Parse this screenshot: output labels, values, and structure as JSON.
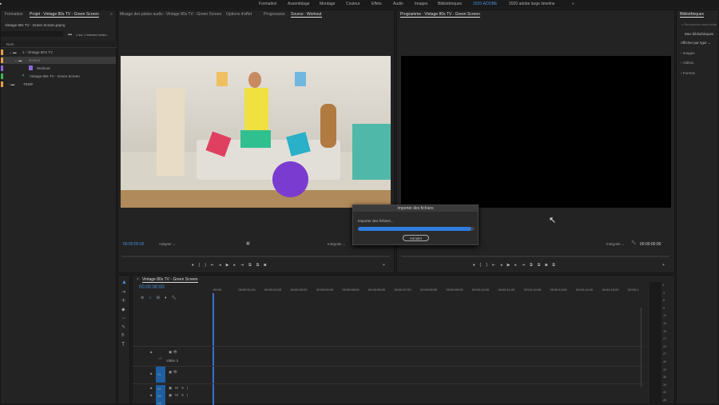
{
  "workspaces": [
    "Formation",
    "Assemblage",
    "Montage",
    "Couleur",
    "Effets",
    "Audio",
    "Images",
    "Bibliothèques",
    "2020-ADOBE",
    "2020 adobe large timeline"
  ],
  "workspace_active": "2020-ADOBE",
  "project": {
    "tab_formation": "Formation",
    "tab_project": "Projet : Vintage 80s TV - Green Screen",
    "file": "Vintage 80s TV - Green Screen.prproj",
    "selection": "1 sur 1 élément sélec...",
    "col_name": "Nom",
    "items": [
      {
        "label": "1 - Vintage 80's TV",
        "color": "#e8a03c"
      },
      {
        "label": "Source",
        "color": "#e8a03c"
      },
      {
        "label": "Workout",
        "color": "#8a6ad8"
      },
      {
        "label": "Vintage 80s TV - Green Screen",
        "color": "#3cb84a"
      },
      {
        "label": "TEMP",
        "color": "#e8a03c"
      }
    ]
  },
  "source": {
    "tabs": [
      "Mixage des pistes audio : Vintage 80s TV - Green Screen",
      "Options d'effet",
      "Progression",
      "Source : Workout"
    ],
    "timecode": "00:00:00:00",
    "fit": "Adapter",
    "quality": "Intégrale"
  },
  "program": {
    "tab": "Programme : Vintage 80s TV - Green Screen",
    "timecode": "00:00:00:00",
    "quality": "Intégrale"
  },
  "libraries": {
    "tab": "Bibliothèques",
    "search_placeholder": "Rechercher dans Adob",
    "my_libs": "Mes bibliothèques",
    "view_by": "Afficher par type",
    "sections": [
      "Images",
      "Vidéos",
      "Formes"
    ]
  },
  "dialog": {
    "title": "Importer des fichiers",
    "message": "Importer des fichiers...",
    "progress": 0.97,
    "cancel": "Annuler"
  },
  "timeline": {
    "tab": "Vintage 80s TV - Green Screen",
    "timecode": "00:00:00:00",
    "ruler": [
      ":00:00",
      "00:00:01:00",
      "00:00:02:00",
      "00:00:03:00",
      "00:00:04:00",
      "00:00:05:00",
      "00:00:06:00",
      "00:00:07:00",
      "00:00:08:00",
      "00:00:09:00",
      "00:00:10:00",
      "00:00:11:00",
      "00:00:12:00",
      "00:00:13:00",
      "00:00:14:00",
      "00:00:15:00",
      "00:00:1"
    ],
    "tracks": [
      {
        "id": "V2",
        "name": "Vidéo 2"
      },
      {
        "id": "V1",
        "name": ""
      },
      {
        "id": "A1"
      },
      {
        "id": "A2"
      },
      {
        "id": "A3"
      }
    ],
    "meter": [
      "0",
      "-3",
      "-6",
      "-9",
      "-12",
      "-15",
      "-18",
      "-21",
      "-24",
      "-27",
      "-30",
      "-33",
      "-36",
      "-39",
      "-42",
      "-45"
    ]
  }
}
